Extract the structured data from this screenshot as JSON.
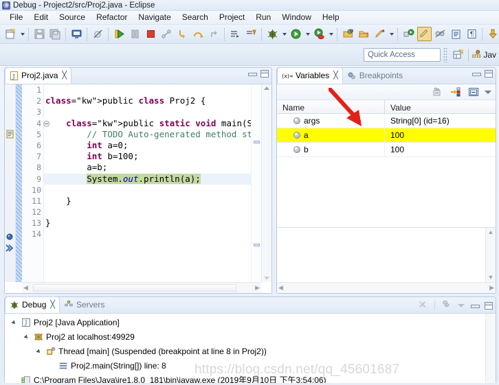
{
  "window": {
    "title": "Debug - Project2/src/Proj2.java - Eclipse",
    "app_icon": "eclipse-icon"
  },
  "menubar": {
    "items": [
      {
        "label": "File"
      },
      {
        "label": "Edit"
      },
      {
        "label": "Source"
      },
      {
        "label": "Refactor"
      },
      {
        "label": "Navigate"
      },
      {
        "label": "Search"
      },
      {
        "label": "Project"
      },
      {
        "label": "Run"
      },
      {
        "label": "Window"
      },
      {
        "label": "Help"
      }
    ]
  },
  "toolbar": {
    "buttons": [
      {
        "name": "new-wizard-icon",
        "title": "New"
      },
      {
        "name": "new-wizard-dropdown-icon",
        "title": "New dropdown"
      },
      {
        "name": "save-icon",
        "title": "Save"
      },
      {
        "name": "save-all-icon",
        "title": "Save All"
      },
      {
        "name": "console-icon",
        "title": "Display Selected Console"
      },
      {
        "name": "skip-breakpoints-icon",
        "title": "Skip All Breakpoints"
      },
      {
        "name": "resume-icon",
        "title": "Resume"
      },
      {
        "name": "suspend-icon",
        "title": "Suspend"
      },
      {
        "name": "terminate-icon",
        "title": "Terminate"
      },
      {
        "name": "disconnect-icon",
        "title": "Disconnect"
      },
      {
        "name": "step-into-icon",
        "title": "Step Into"
      },
      {
        "name": "step-over-icon",
        "title": "Step Over"
      },
      {
        "name": "step-return-icon",
        "title": "Step Return"
      },
      {
        "name": "build-all-icon",
        "title": "Build All"
      },
      {
        "name": "next-annotation-icon",
        "title": "Next Annotation"
      },
      {
        "name": "debug-icon",
        "title": "Debug"
      },
      {
        "name": "debug-dropdown-icon",
        "title": "Debug dropdown"
      },
      {
        "name": "run-icon",
        "title": "Run"
      },
      {
        "name": "run-dropdown-icon",
        "title": "Run dropdown"
      },
      {
        "name": "run-coverage-icon",
        "title": "Coverage"
      },
      {
        "name": "coverage-dropdown-icon",
        "title": "Coverage dropdown"
      },
      {
        "name": "open-type-icon",
        "title": "Open Type"
      },
      {
        "name": "open-task-icon",
        "title": "Open Task"
      },
      {
        "name": "search-pencil-icon",
        "title": "Search"
      },
      {
        "name": "search-dropdown-icon",
        "title": "Search dropdown"
      },
      {
        "name": "external-tools-icon",
        "title": "External Tools"
      },
      {
        "name": "toggle-mark-occurrences-icon",
        "title": "Toggle Mark Occurrences"
      },
      {
        "name": "link-with-editor-icon",
        "title": "Link"
      },
      {
        "name": "show-whitespace-icon",
        "title": "Show Whitespace"
      },
      {
        "name": "pilcrow-icon",
        "title": "Paragraph"
      },
      {
        "name": "last-edit-icon",
        "title": "Last Edit Location"
      }
    ]
  },
  "quick_access": {
    "placeholder": "Quick Access",
    "value": "",
    "open_perspective_icon": "open-perspective-icon",
    "perspective_icon": "java-perspective-icon",
    "perspective_label": "Jav"
  },
  "editor": {
    "tab": {
      "label": "Proj2.java",
      "icon": "java-file-icon",
      "close": "╳",
      "active": true
    },
    "controls": {
      "minimize": "minimize-icon",
      "maximize": "maximize-icon"
    },
    "lines": [
      {
        "num": "1",
        "fold": false,
        "text": "",
        "highlight": "none"
      },
      {
        "num": "2",
        "fold": false,
        "text": "public class Proj2 {",
        "highlight": "none"
      },
      {
        "num": "3",
        "fold": false,
        "text": "",
        "highlight": "none"
      },
      {
        "num": "4",
        "fold": true,
        "text": "    public static void main(String[] args) {",
        "highlight": "none"
      },
      {
        "num": "5",
        "fold": false,
        "text": "        // TODO Auto-generated method stub",
        "highlight": "none"
      },
      {
        "num": "6",
        "fold": false,
        "text": "        int a=0;",
        "highlight": "none"
      },
      {
        "num": "7",
        "fold": false,
        "text": "        int b=100;",
        "highlight": "none"
      },
      {
        "num": "8",
        "fold": false,
        "text": "        a=b;",
        "highlight": "none"
      },
      {
        "num": "9",
        "fold": false,
        "text": "        System.out.println(a);",
        "highlight": "exec"
      },
      {
        "num": "10",
        "fold": false,
        "text": "",
        "highlight": "none"
      },
      {
        "num": "11",
        "fold": false,
        "text": "    }",
        "highlight": "none"
      },
      {
        "num": "12",
        "fold": false,
        "text": "",
        "highlight": "none"
      },
      {
        "num": "13",
        "fold": false,
        "text": "}",
        "highlight": "none"
      },
      {
        "num": "14",
        "fold": false,
        "text": "",
        "highlight": "none"
      }
    ],
    "gutter_markers": [
      {
        "name": "todo-marker-icon",
        "line": 5
      },
      {
        "name": "breakpoint-marker-icon",
        "line": 8
      },
      {
        "name": "current-instruction-pointer-icon",
        "line": 9
      }
    ]
  },
  "variables": {
    "tabs": [
      {
        "label": "Variables",
        "icon": "variables-icon",
        "active": true,
        "close": "╳"
      },
      {
        "label": "Breakpoints",
        "icon": "breakpoints-icon",
        "active": false
      }
    ],
    "toolbar": [
      {
        "name": "collapse-all-icon"
      },
      {
        "name": "show-logical-structure-icon"
      },
      {
        "name": "layout-icon"
      },
      {
        "name": "view-menu-icon"
      }
    ],
    "columns": [
      "Name",
      "Value"
    ],
    "rows": [
      {
        "name": "args",
        "value": "String[0]  (id=16)",
        "highlight": false
      },
      {
        "name": "a",
        "value": "100",
        "highlight": true
      },
      {
        "name": "b",
        "value": "100",
        "highlight": false
      }
    ],
    "detail_text": ""
  },
  "debug_view": {
    "tabs": [
      {
        "label": "Debug",
        "icon": "debug-bug-icon",
        "active": true,
        "close": "╳"
      },
      {
        "label": "Servers",
        "icon": "servers-icon",
        "active": false
      }
    ],
    "controls": [
      {
        "name": "remove-all-terminated-icon"
      },
      {
        "name": "relaunch-icon"
      },
      {
        "name": "view-menu-icon"
      },
      {
        "name": "minimize-icon"
      },
      {
        "name": "maximize-icon"
      }
    ],
    "tree": [
      {
        "depth": 0,
        "twisty": true,
        "icon": "java-application-icon",
        "label": "Proj2 [Java Application]"
      },
      {
        "depth": 1,
        "twisty": true,
        "icon": "debug-target-icon",
        "label": "Proj2 at localhost:49929"
      },
      {
        "depth": 2,
        "twisty": true,
        "icon": "thread-icon",
        "label": "Thread [main] (Suspended (breakpoint at line 8 in Proj2))"
      },
      {
        "depth": 3,
        "twisty": false,
        "icon": "stack-frame-icon",
        "label": "Proj2.main(String[]) line: 8"
      },
      {
        "depth": 0,
        "twisty": false,
        "icon": "process-icon",
        "label": "C:\\Program Files\\Java\\jre1.8.0_181\\bin\\javaw.exe (2019年9月10日 下午3:54:06)"
      }
    ]
  },
  "annotation": {
    "arrow": "red-arrow-pointing-to-variable-a-value",
    "color": "#e32119"
  },
  "watermark": {
    "text": "https://blog.csdn.net/qq_45601687"
  },
  "colors": {
    "highlight_row": "#ffff00",
    "exec_line": "#c3d9a3",
    "current_line": "#eaf3fc",
    "keyword": "#7f0055",
    "comment": "#3f7f5f",
    "field": "#0000c0",
    "panel_border": "#b6c9e2"
  }
}
